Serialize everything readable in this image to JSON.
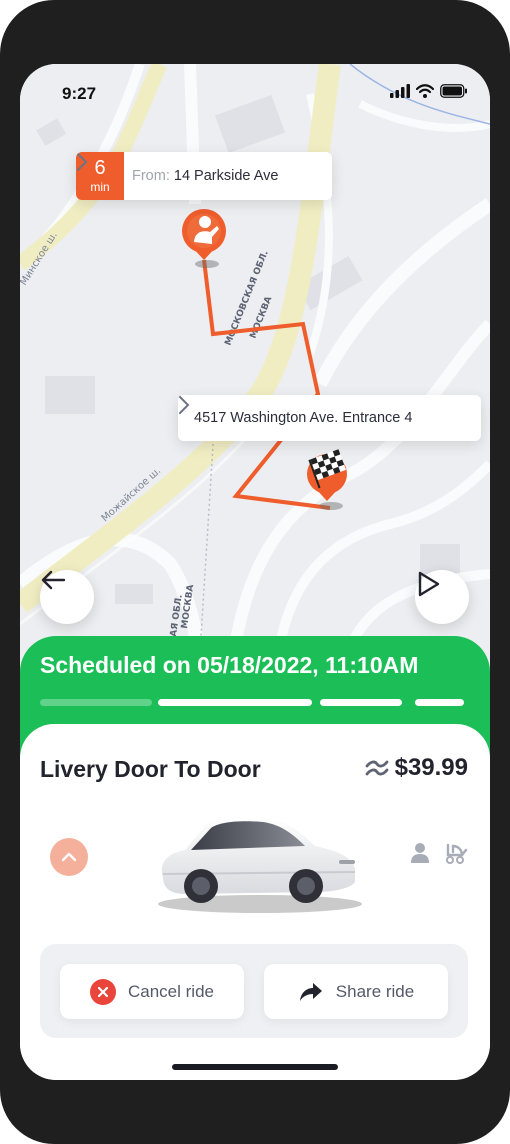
{
  "status_bar": {
    "time": "9:27"
  },
  "map": {
    "street_labels": [
      "Минское ш.",
      "Можайское ш.",
      "МОСКОВСКАЯ ОБЛ.",
      "МОСКВА",
      "СКОВСКАЯ ОБЛ.",
      "МОСКВА"
    ],
    "origin": {
      "eta_value": "6",
      "eta_unit": "min",
      "prefix": "From:",
      "address": "14 Parkside Ave"
    },
    "destination": {
      "address": "4517 Washington Ave. Entrance 4"
    },
    "route_color": "#ee5d2b"
  },
  "banner": {
    "title": "Scheduled on 05/18/2022, 11:10AM",
    "progress_segments": [
      {
        "filled": false
      },
      {
        "filled": true
      },
      {
        "filled": true
      },
      {
        "filled": true
      }
    ],
    "color": "#1cbf57"
  },
  "ride": {
    "name": "Livery Door To Door",
    "price": "$39.99",
    "approx_icon": "approx-icon",
    "option_icons": [
      "person-icon",
      "stroller-icon"
    ]
  },
  "actions": {
    "cancel_label": "Cancel ride",
    "share_label": "Share ride"
  }
}
